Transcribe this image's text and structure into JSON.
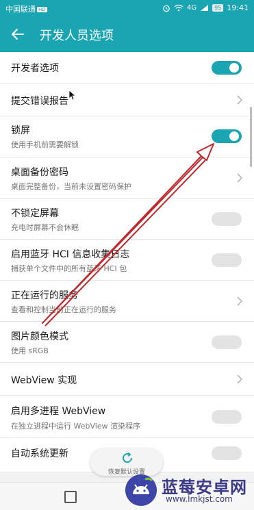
{
  "status_bar": {
    "carrier": "中国联通",
    "carrier_badge": "HD",
    "network": "4G",
    "battery": "95",
    "time": "19:41"
  },
  "header": {
    "title": "开发人员选项",
    "back_icon": "arrow-left-icon"
  },
  "settings": [
    {
      "label": "开发者选项",
      "sub": "",
      "control": "toggle",
      "on": true
    },
    {
      "label": "提交错误报告",
      "sub": "",
      "control": "chevron"
    },
    {
      "label": "锁屏",
      "sub": "使用手机前需要解锁",
      "control": "toggle",
      "on": true
    },
    {
      "label": "桌面备份密码",
      "sub": "桌面完整备份，当前未设置密码保护",
      "control": "chevron"
    },
    {
      "label": "不锁定屏幕",
      "sub": "充电时屏幕不会休眠",
      "control": "toggle",
      "on": false
    },
    {
      "label": "启用蓝牙 HCI 信息收集日志",
      "sub": "捕获单个文件中的所有蓝牙 HCI 包",
      "control": "toggle",
      "on": false
    },
    {
      "label": "正在运行的服务",
      "sub": "查看和控制当前正在运行的服务",
      "control": "chevron"
    },
    {
      "label": "图片颜色模式",
      "sub": "使用 sRGB",
      "control": "toggle",
      "on": false
    },
    {
      "label": "WebView 实现",
      "sub": "",
      "control": "chevron"
    },
    {
      "label": "启用多进程 WebView",
      "sub": "在独立进程中运行 WebView 渲染程序",
      "control": "toggle",
      "on": false
    },
    {
      "label": "自动系统更新",
      "sub": "",
      "control": "toggle",
      "on": false
    }
  ],
  "fab": {
    "label": "恢复默认设置",
    "icon": "refresh-icon"
  },
  "watermark": {
    "name": "蓝莓安卓网",
    "url": "www.lmkjst.com"
  },
  "colors": {
    "accent": "#1aa5b3",
    "annotation_arrow": "#c0282d"
  }
}
